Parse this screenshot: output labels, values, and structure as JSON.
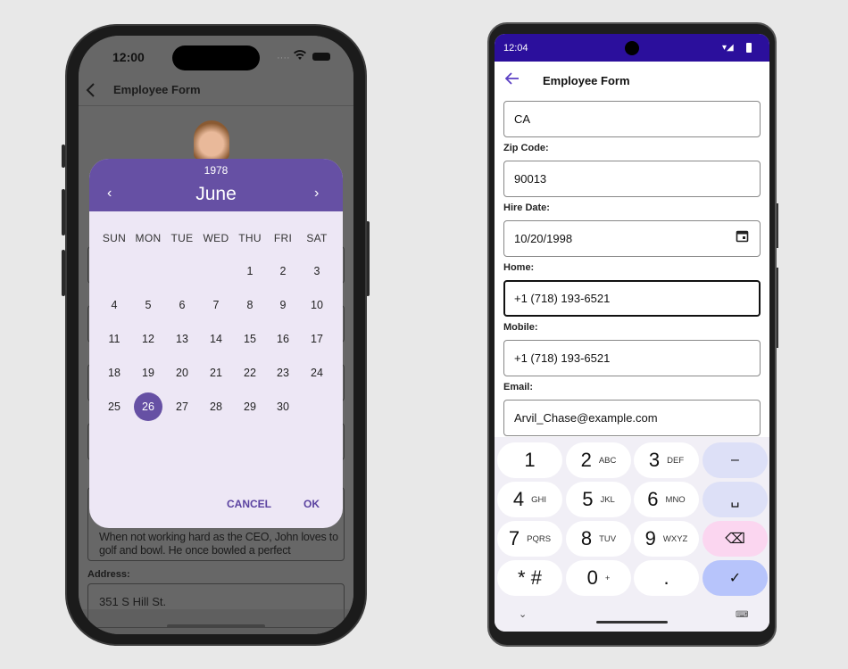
{
  "ios": {
    "status_time": "12:00",
    "header_title": "Employee Form",
    "back_icon": "chevron-left-icon",
    "notes_text": "When not working hard as the CEO, John loves to golf and bowl. He once bowled a perfect",
    "address_label": "Address:",
    "address_value": "351 S Hill St.",
    "datepicker": {
      "year": "1978",
      "month": "June",
      "weekdays": [
        "SUN",
        "MON",
        "TUE",
        "WED",
        "THU",
        "FRI",
        "SAT"
      ],
      "first_weekday_index": 4,
      "days_in_month": 30,
      "selected_day": 26,
      "cancel_label": "CANCEL",
      "ok_label": "OK",
      "accent_color": "#6650a4"
    }
  },
  "android": {
    "status_time": "12:04",
    "header_title": "Employee Form",
    "status_bar_color": "#2b0f9c",
    "fields": [
      {
        "label": "",
        "value": "CA"
      },
      {
        "label": "Zip Code:",
        "value": "90013"
      },
      {
        "label": "Hire Date:",
        "value": "10/20/1998",
        "icon": "calendar-icon"
      },
      {
        "label": "Home:",
        "value": "+1 (718) 193-6521",
        "focused": true
      },
      {
        "label": "Mobile:",
        "value": "+1 (718) 193-6521"
      },
      {
        "label": "Email:",
        "value": "Arvil_Chase@example.com"
      }
    ],
    "keyboard": {
      "rows": [
        [
          {
            "main": "1",
            "sub": ""
          },
          {
            "main": "2",
            "sub": "ABC"
          },
          {
            "main": "3",
            "sub": "DEF"
          },
          {
            "main": "–",
            "sub": "",
            "type": "fn"
          }
        ],
        [
          {
            "main": "4",
            "sub": "GHI"
          },
          {
            "main": "5",
            "sub": "JKL"
          },
          {
            "main": "6",
            "sub": "MNO"
          },
          {
            "main": "␣",
            "sub": "",
            "type": "fn"
          }
        ],
        [
          {
            "main": "7",
            "sub": "PQRS"
          },
          {
            "main": "8",
            "sub": "TUV"
          },
          {
            "main": "9",
            "sub": "WXYZ"
          },
          {
            "main": "⌫",
            "sub": "",
            "type": "del"
          }
        ],
        [
          {
            "main": "* #",
            "sub": ""
          },
          {
            "main": "0",
            "sub": "+"
          },
          {
            "main": ".",
            "sub": ""
          },
          {
            "main": "✓",
            "sub": "",
            "type": "ok"
          }
        ]
      ]
    }
  }
}
